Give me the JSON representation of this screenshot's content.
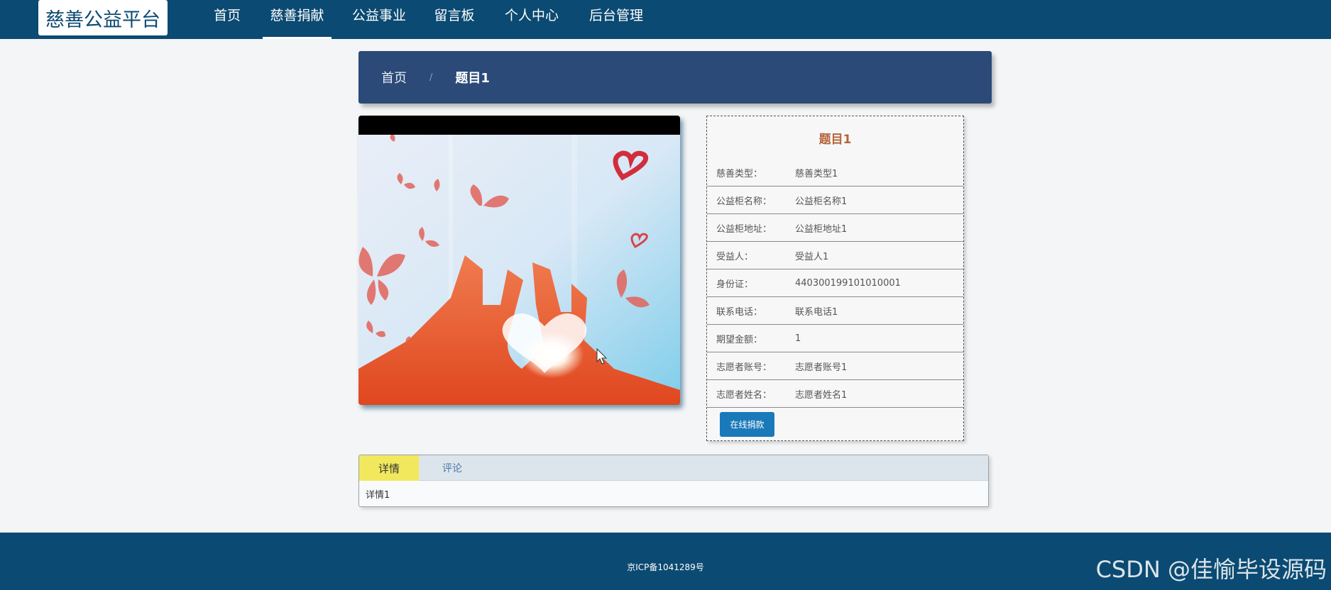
{
  "header": {
    "logo_text": "慈善公益平台",
    "nav": [
      {
        "label": "首页"
      },
      {
        "label": "慈善捐献"
      },
      {
        "label": "公益事业"
      },
      {
        "label": "留言板"
      },
      {
        "label": "个人中心"
      },
      {
        "label": "后台管理"
      }
    ],
    "active_index": 1
  },
  "breadcrumb": {
    "home": "首页",
    "separator": "/",
    "current": "题目1"
  },
  "detail": {
    "title": "题目1",
    "fields": [
      {
        "label": "慈善类型：",
        "value": "慈善类型1"
      },
      {
        "label": "公益柜名称：",
        "value": "公益柜名称1"
      },
      {
        "label": "公益柜地址：",
        "value": "公益柜地址1"
      },
      {
        "label": "受益人：",
        "value": "受益人1"
      },
      {
        "label": "身份证：",
        "value": "440300199101010001"
      },
      {
        "label": "联系电话：",
        "value": "联系电话1"
      },
      {
        "label": "期望金额：",
        "value": "1"
      },
      {
        "label": "志愿者账号：",
        "value": "志愿者账号1"
      },
      {
        "label": "志愿者姓名：",
        "value": "志愿者姓名1"
      }
    ],
    "donate_button": "在线捐款"
  },
  "tabs": {
    "items": [
      {
        "label": "详情"
      },
      {
        "label": "评论"
      }
    ],
    "active_index": 0,
    "content": "详情1"
  },
  "footer": {
    "icp": "京ICP备1041289号",
    "watermark": "CSDN @佳愉毕设源码"
  },
  "colors": {
    "primary": "#0b4a72",
    "breadcrumb_bg": "#2b4a78",
    "title_accent": "#b5643a",
    "button": "#1a79b9",
    "active_tab": "#f2e85e"
  }
}
